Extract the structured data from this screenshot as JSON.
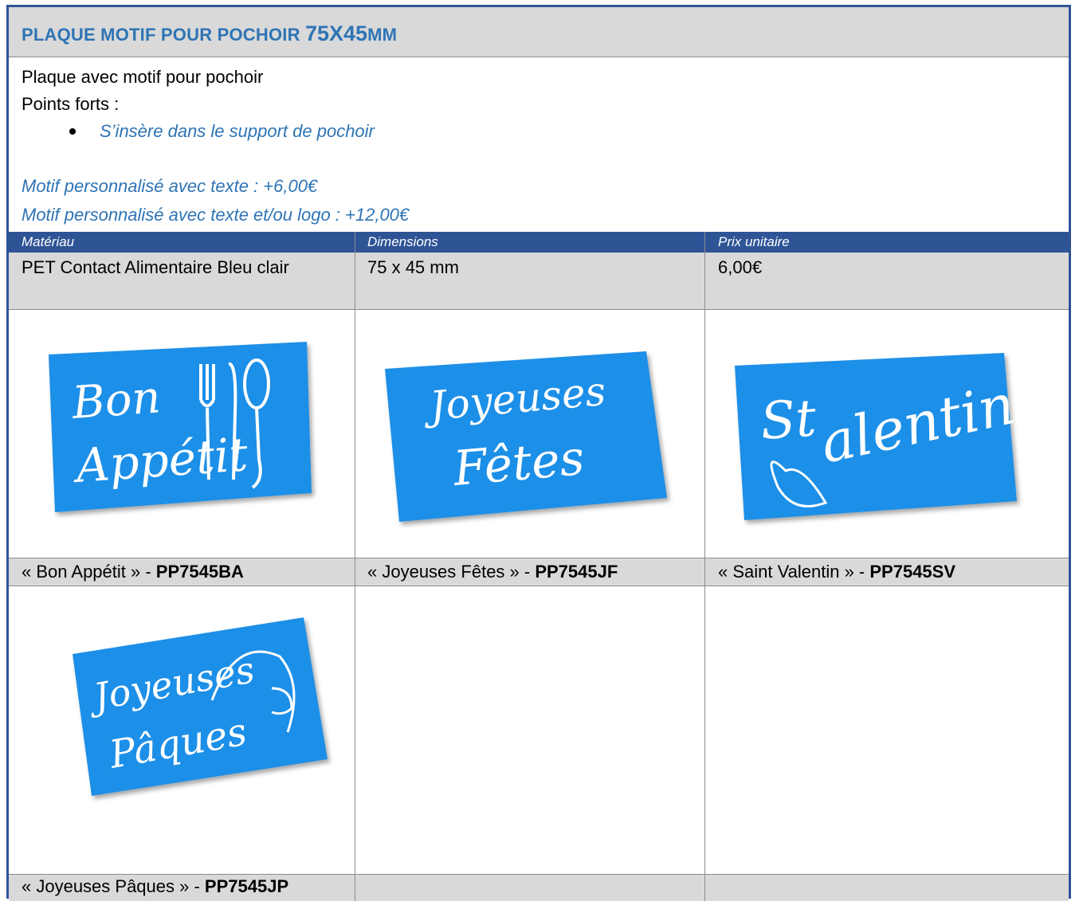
{
  "title": {
    "part1": "PLAQUE MOTIF POUR POCHOIR ",
    "part2": "75X45",
    "part3": "MM"
  },
  "description": {
    "line1": "Plaque avec motif pour pochoir",
    "line2": "Points forts :",
    "bullet": "S’insère dans le support de pochoir"
  },
  "options": [
    "Motif personnalisé avec texte : +6,00€",
    "Motif personnalisé avec texte et/ou logo : +12,00€"
  ],
  "table": {
    "headers": [
      "Matériau",
      "Dimensions",
      "Prix unitaire"
    ],
    "row": [
      "PET Contact Alimentaire Bleu clair",
      "75 x 45 mm",
      "6,00€"
    ]
  },
  "products": [
    {
      "name": "« Bon Appétit » - ",
      "code": "PP7545BA",
      "motif_line1": "Bon",
      "motif_line2": "Appétit"
    },
    {
      "name": "« Joyeuses Fêtes » - ",
      "code": "PP7545JF",
      "motif_line1": "Joyeuses",
      "motif_line2": "Fêtes"
    },
    {
      "name": "« Saint Valentin » - ",
      "code": "PP7545SV",
      "motif_line1": "St",
      "motif_line2": "alentin"
    },
    {
      "name": "« Joyeuses Pâques » - ",
      "code": "PP7545JP",
      "motif_line1": "Joyeuses",
      "motif_line2": "Pâques"
    }
  ],
  "colors": {
    "accent": "#2e74b5",
    "header": "#2f5496",
    "stencil": "#1e8fe8",
    "row_gray": "#d9d9d9"
  }
}
